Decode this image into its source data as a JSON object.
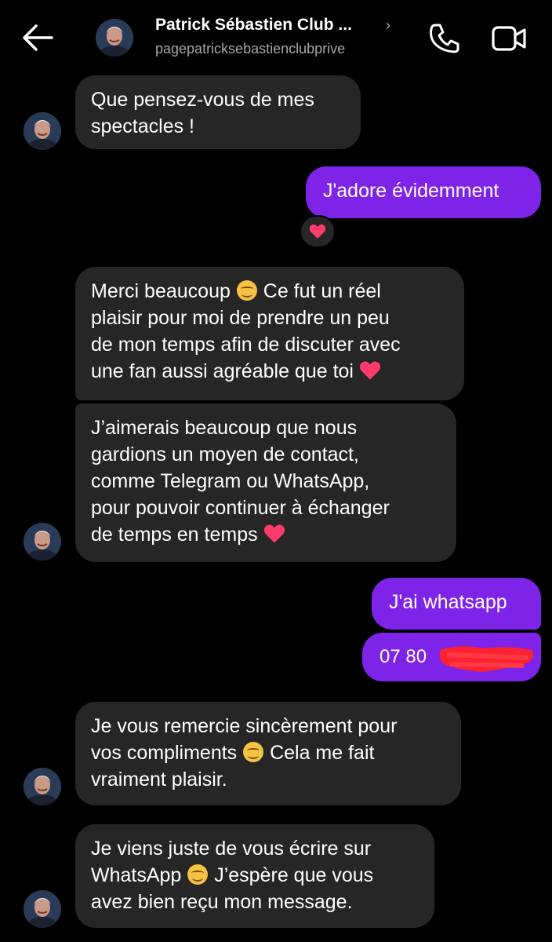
{
  "header": {
    "title": "Patrick Sébastien Club ...",
    "username": "pagepatricksebastienclubprive",
    "chevron": "›",
    "icons": [
      "back-arrow-icon",
      "phone-icon",
      "video-camera-icon"
    ]
  },
  "messages": {
    "m1": {
      "line1": "Que pensez-vous de mes",
      "line2": "spectacles !"
    },
    "m2": {
      "line1": "J'adore évidemment"
    },
    "m3": {
      "line1_a": "Merci beaucoup ",
      "line1_b": " Ce fut un réel",
      "line2": "plaisir pour moi de prendre un peu",
      "line3": "de mon temps afin de discuter avec",
      "line4": "une fan aussi agréable que toi "
    },
    "m4": {
      "line1": "J’aimerais beaucoup que nous",
      "line2": "gardions un moyen de contact,",
      "line3": "comme Telegram ou WhatsApp,",
      "line4": "pour pouvoir continuer à échanger",
      "line5": "de temps en temps "
    },
    "m5": {
      "line1": "J'ai whatsapp"
    },
    "m6": {
      "line1": "07 80 "
    },
    "m7": {
      "line1": "Je vous remercie sincèrement pour",
      "line2_a": "vos compliments ",
      "line2_b": " Cela me fait",
      "line3": "vraiment plaisir."
    },
    "m8": {
      "line1": "Je viens juste de vous écrire sur",
      "line2_a": "WhatsApp ",
      "line2_b": " J’espère que vous",
      "line3": "avez bien reçu mon message."
    }
  },
  "colors": {
    "background": "#000000",
    "incoming": "#262626",
    "outgoing": "#7e23e8",
    "heart": "#ff3b6b",
    "redaction": "#ff2030"
  }
}
